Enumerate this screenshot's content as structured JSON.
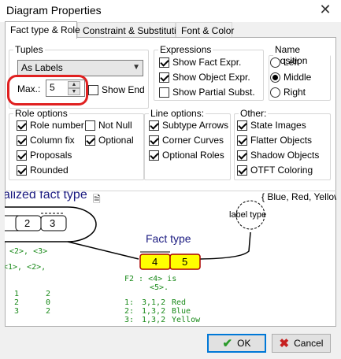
{
  "window": {
    "title": "Diagram Properties",
    "close_glyph": "✕"
  },
  "tabs": [
    {
      "label": "Fact type & Role",
      "active": true
    },
    {
      "label": "Constraint & Substitution",
      "active": false
    },
    {
      "label": "Font & Color",
      "active": false
    }
  ],
  "tuples": {
    "legend": "Tuples",
    "display_value": "As Labels",
    "max_label": "Max.:",
    "max_value": "5",
    "show_end_label": "Show End",
    "show_end_checked": false
  },
  "expressions": {
    "legend": "Expressions",
    "items": [
      {
        "label": "Show Fact Expr.",
        "checked": true
      },
      {
        "label": "Show Object Expr.",
        "checked": true
      },
      {
        "label": "Show Partial Subst.",
        "checked": false
      }
    ]
  },
  "name_position": {
    "legend": "Name position",
    "options": [
      {
        "label": "Left",
        "selected": false
      },
      {
        "label": "Middle",
        "selected": true
      },
      {
        "label": "Right",
        "selected": false
      }
    ]
  },
  "role_options": {
    "legend": "Role options",
    "items": [
      {
        "label": "Role number",
        "checked": true
      },
      {
        "label": "Not Null",
        "checked": false
      },
      {
        "label": "Column fix",
        "checked": true
      },
      {
        "label": "Optional",
        "checked": true
      },
      {
        "label": "Proposals",
        "checked": true
      },
      {
        "label": "Rounded",
        "checked": true
      }
    ]
  },
  "line_options": {
    "legend": "Line options:",
    "items": [
      {
        "label": "Subtype Arrows",
        "checked": true
      },
      {
        "label": "Corner Curves",
        "checked": true
      },
      {
        "label": "Optional Roles",
        "checked": true
      }
    ]
  },
  "other": {
    "legend": "Other:",
    "items": [
      {
        "label": "State Images",
        "checked": true
      },
      {
        "label": "Flatter Objects",
        "checked": true
      },
      {
        "label": "Shadow Objects",
        "checked": true
      },
      {
        "label": "OTFT Coloring",
        "checked": true
      }
    ]
  },
  "preview": {
    "heading": "alized fact type",
    "set_text": "{ Blue, Red, Yellow",
    "label_type": "label type",
    "fact_type_label": "Fact type",
    "role_boxes": [
      "2",
      "3"
    ],
    "fact_roles": [
      "4",
      "5"
    ],
    "left_lines": [
      "<2>, <3>",
      "<1>, <2>,"
    ],
    "expr": [
      "F2 : <4> is",
      "<5>."
    ],
    "left_table": [
      [
        "1",
        "2"
      ],
      [
        "2",
        "0"
      ],
      [
        "3",
        "2"
      ]
    ],
    "right_table": [
      [
        "1:",
        "3,1,2",
        "Red"
      ],
      [
        "2:",
        "1,3,2",
        "Blue"
      ],
      [
        "3:",
        "1,3,2",
        "Yellow"
      ]
    ]
  },
  "buttons": {
    "ok": "OK",
    "cancel": "Cancel"
  },
  "colors": {
    "accent": "#0078d7",
    "highlight": "#e02020",
    "fact_fill": "#ffff00",
    "tuple_green": "#1a8a1a",
    "navy": "#1a1a80"
  }
}
